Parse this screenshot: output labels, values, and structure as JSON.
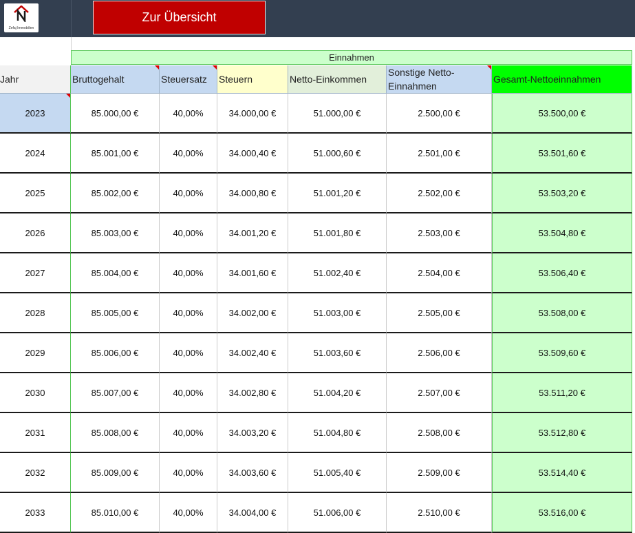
{
  "logo": {
    "text": "Zefaj Immobilien",
    "icon": "house-logo-icon"
  },
  "nav": {
    "button_label": "Zur Übersicht"
  },
  "group_header": "Einnahmen",
  "columns": [
    {
      "key": "jahr",
      "label": "Jahr",
      "bg": "#f2f2f2"
    },
    {
      "key": "brutto",
      "label": "Bruttogehalt",
      "bg": "#c5d9f1"
    },
    {
      "key": "satz",
      "label": "Steuersatz",
      "bg": "#c5d9f1"
    },
    {
      "key": "steuern",
      "label": "Steuern",
      "bg": "#ffffcc"
    },
    {
      "key": "netto",
      "label": "Netto-Einkommen",
      "bg": "#e2efda"
    },
    {
      "key": "sonst",
      "label": "Sonstige Netto-Einnahmen",
      "bg": "#c5d9f1"
    },
    {
      "key": "gesamt",
      "label": "Gesamt-Nettoeinnahmen",
      "bg": "#00ff00"
    }
  ],
  "rows": [
    {
      "jahr": "2023",
      "brutto": "85.000,00 €",
      "satz": "40,00%",
      "steuern": "34.000,00 €",
      "netto": "51.000,00 €",
      "sonst": "2.500,00 €",
      "gesamt": "53.500,00 €"
    },
    {
      "jahr": "2024",
      "brutto": "85.001,00 €",
      "satz": "40,00%",
      "steuern": "34.000,40 €",
      "netto": "51.000,60 €",
      "sonst": "2.501,00 €",
      "gesamt": "53.501,60 €"
    },
    {
      "jahr": "2025",
      "brutto": "85.002,00 €",
      "satz": "40,00%",
      "steuern": "34.000,80 €",
      "netto": "51.001,20 €",
      "sonst": "2.502,00 €",
      "gesamt": "53.503,20 €"
    },
    {
      "jahr": "2026",
      "brutto": "85.003,00 €",
      "satz": "40,00%",
      "steuern": "34.001,20 €",
      "netto": "51.001,80 €",
      "sonst": "2.503,00 €",
      "gesamt": "53.504,80 €"
    },
    {
      "jahr": "2027",
      "brutto": "85.004,00 €",
      "satz": "40,00%",
      "steuern": "34.001,60 €",
      "netto": "51.002,40 €",
      "sonst": "2.504,00 €",
      "gesamt": "53.506,40 €"
    },
    {
      "jahr": "2028",
      "brutto": "85.005,00 €",
      "satz": "40,00%",
      "steuern": "34.002,00 €",
      "netto": "51.003,00 €",
      "sonst": "2.505,00 €",
      "gesamt": "53.508,00 €"
    },
    {
      "jahr": "2029",
      "brutto": "85.006,00 €",
      "satz": "40,00%",
      "steuern": "34.002,40 €",
      "netto": "51.003,60 €",
      "sonst": "2.506,00 €",
      "gesamt": "53.509,60 €"
    },
    {
      "jahr": "2030",
      "brutto": "85.007,00 €",
      "satz": "40,00%",
      "steuern": "34.002,80 €",
      "netto": "51.004,20 €",
      "sonst": "2.507,00 €",
      "gesamt": "53.511,20 €"
    },
    {
      "jahr": "2031",
      "brutto": "85.008,00 €",
      "satz": "40,00%",
      "steuern": "34.003,20 €",
      "netto": "51.004,80 €",
      "sonst": "2.508,00 €",
      "gesamt": "53.512,80 €"
    },
    {
      "jahr": "2032",
      "brutto": "85.009,00 €",
      "satz": "40,00%",
      "steuern": "34.003,60 €",
      "netto": "51.005,40 €",
      "sonst": "2.509,00 €",
      "gesamt": "53.514,40 €"
    },
    {
      "jahr": "2033",
      "brutto": "85.010,00 €",
      "satz": "40,00%",
      "steuern": "34.004,00 €",
      "netto": "51.006,00 €",
      "sonst": "2.510,00 €",
      "gesamt": "53.516,00 €"
    }
  ],
  "colors": {
    "topbar": "#333f50",
    "button": "#c00000",
    "total_column": "#ccffcc",
    "total_header": "#00ff00",
    "selected_year": "#c5d9f1",
    "comment_marker": "#e00000"
  }
}
